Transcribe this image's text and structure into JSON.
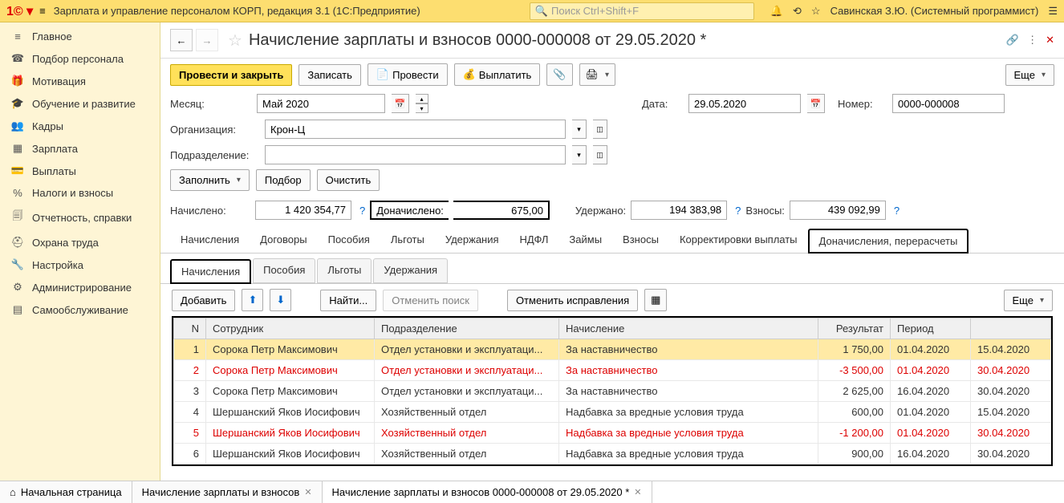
{
  "header": {
    "app_title": "Зарплата и управление персоналом КОРП, редакция 3.1  (1С:Предприятие)",
    "search_placeholder": "Поиск Ctrl+Shift+F",
    "user": "Савинская З.Ю. (Системный программист)"
  },
  "sidebar": {
    "items": [
      {
        "icon": "≡",
        "label": "Главное"
      },
      {
        "icon": "☎",
        "label": "Подбор персонала"
      },
      {
        "icon": "🎁",
        "label": "Мотивация"
      },
      {
        "icon": "🎓",
        "label": "Обучение и развитие"
      },
      {
        "icon": "👥",
        "label": "Кадры"
      },
      {
        "icon": "▦",
        "label": "Зарплата"
      },
      {
        "icon": "💳",
        "label": "Выплаты"
      },
      {
        "icon": "%",
        "label": "Налоги и взносы"
      },
      {
        "icon": "🗐",
        "label": "Отчетность, справки"
      },
      {
        "icon": "⛑",
        "label": "Охрана труда"
      },
      {
        "icon": "🔧",
        "label": "Настройка"
      },
      {
        "icon": "⚙",
        "label": "Администрирование"
      },
      {
        "icon": "▤",
        "label": "Самообслуживание"
      }
    ]
  },
  "doc": {
    "title": "Начисление зарплаты и взносов 0000-000008 от 29.05.2020 *",
    "toolbar": {
      "process_close": "Провести и закрыть",
      "save": "Записать",
      "process": "Провести",
      "pay": "Выплатить",
      "more": "Еще"
    },
    "form": {
      "month_label": "Месяц:",
      "month": "Май 2020",
      "date_label": "Дата:",
      "date": "29.05.2020",
      "number_label": "Номер:",
      "number": "0000-000008",
      "org_label": "Организация:",
      "org": "Крон-Ц",
      "dept_label": "Подразделение:",
      "dept": ""
    },
    "actions": {
      "fill": "Заполнить",
      "select": "Подбор",
      "clear": "Очистить"
    },
    "totals": {
      "accrued_label": "Начислено:",
      "accrued": "1 420 354,77",
      "extra_label": "Доначислено:",
      "extra": "675,00",
      "withheld_label": "Удержано:",
      "withheld": "194 383,98",
      "contrib_label": "Взносы:",
      "contrib": "439 092,99"
    },
    "tabs_main": [
      "Начисления",
      "Договоры",
      "Пособия",
      "Льготы",
      "Удержания",
      "НДФЛ",
      "Займы",
      "Взносы",
      "Корректировки выплаты",
      "Доначисления, перерасчеты"
    ],
    "tabs_sub": [
      "Начисления",
      "Пособия",
      "Льготы",
      "Удержания"
    ],
    "table_toolbar": {
      "add": "Добавить",
      "find": "Найти...",
      "cancel_search": "Отменить поиск",
      "cancel_fix": "Отменить исправления",
      "more": "Еще"
    },
    "table": {
      "headers": {
        "n": "N",
        "emp": "Сотрудник",
        "dept": "Подразделение",
        "accr": "Начисление",
        "res": "Результат",
        "period": "Период",
        "period2": ""
      },
      "rows": [
        {
          "n": "1",
          "emp": "Сорока Петр Максимович",
          "dept": "Отдел установки и эксплуатаци...",
          "accr": "За наставничество",
          "res": "1 750,00",
          "p1": "01.04.2020",
          "p2": "15.04.2020",
          "neg": false,
          "sel": true
        },
        {
          "n": "2",
          "emp": "Сорока Петр Максимович",
          "dept": "Отдел установки и эксплуатаци...",
          "accr": "За наставничество",
          "res": "-3 500,00",
          "p1": "01.04.2020",
          "p2": "30.04.2020",
          "neg": true,
          "sel": false
        },
        {
          "n": "3",
          "emp": "Сорока Петр Максимович",
          "dept": "Отдел установки и эксплуатаци...",
          "accr": "За наставничество",
          "res": "2 625,00",
          "p1": "16.04.2020",
          "p2": "30.04.2020",
          "neg": false,
          "sel": false
        },
        {
          "n": "4",
          "emp": "Шершанский Яков Иосифович",
          "dept": "Хозяйственный отдел",
          "accr": "Надбавка за вредные условия труда",
          "res": "600,00",
          "p1": "01.04.2020",
          "p2": "15.04.2020",
          "neg": false,
          "sel": false
        },
        {
          "n": "5",
          "emp": "Шершанский Яков Иосифович",
          "dept": "Хозяйственный отдел",
          "accr": "Надбавка за вредные условия труда",
          "res": "-1 200,00",
          "p1": "01.04.2020",
          "p2": "30.04.2020",
          "neg": true,
          "sel": false
        },
        {
          "n": "6",
          "emp": "Шершанский Яков Иосифович",
          "dept": "Хозяйственный отдел",
          "accr": "Надбавка за вредные условия труда",
          "res": "900,00",
          "p1": "16.04.2020",
          "p2": "30.04.2020",
          "neg": false,
          "sel": false
        }
      ]
    }
  },
  "bottom_tabs": [
    {
      "icon": "⌂",
      "label": "Начальная страница",
      "close": false
    },
    {
      "icon": "",
      "label": "Начисление зарплаты и взносов",
      "close": true
    },
    {
      "icon": "",
      "label": "Начисление зарплаты и взносов 0000-000008 от 29.05.2020 *",
      "close": true
    }
  ]
}
